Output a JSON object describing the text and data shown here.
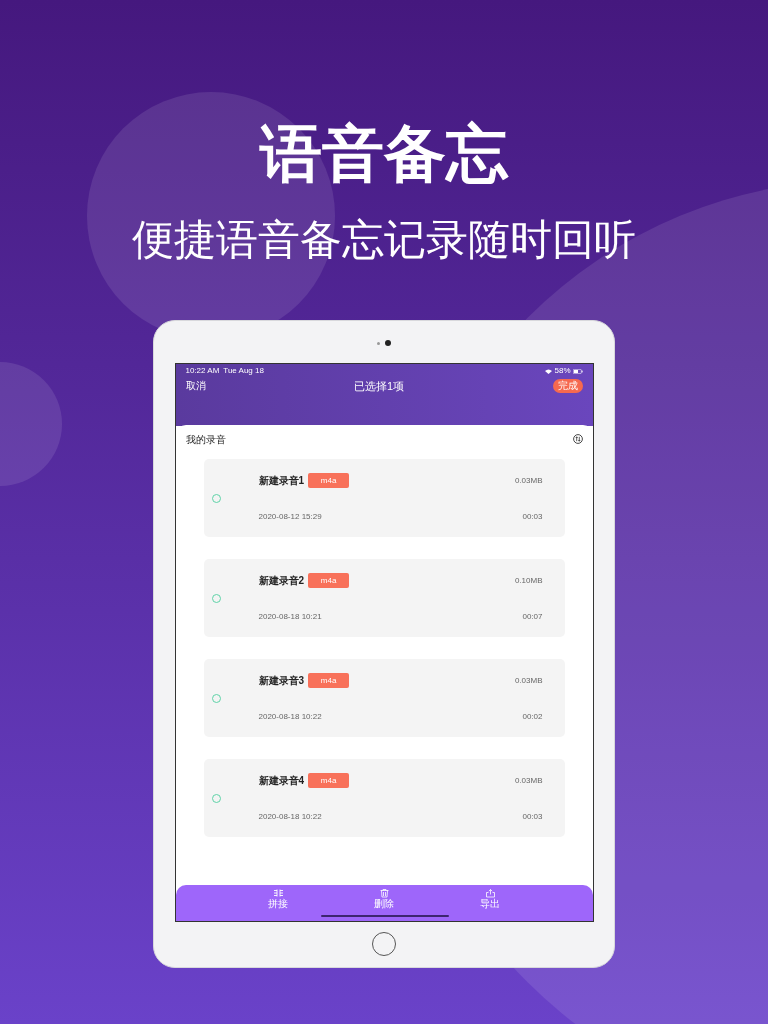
{
  "headline": "语音备忘",
  "subheadline": "便捷语音备忘记录随时回听",
  "status_bar": {
    "time": "10:22 AM",
    "date": "Tue Aug 18",
    "battery": "58%"
  },
  "nav": {
    "cancel": "取消",
    "title": "已选择1项",
    "done": "完成"
  },
  "section_title": "我的录音",
  "recordings": [
    {
      "name": "新建录音1",
      "format": "m4a",
      "size": "0.03MB",
      "date": "2020-08-12 15:29",
      "duration": "00:03",
      "selected": false
    },
    {
      "name": "新建录音2",
      "format": "m4a",
      "size": "0.10MB",
      "date": "2020-08-18 10:21",
      "duration": "00:07",
      "selected": false
    },
    {
      "name": "新建录音3",
      "format": "m4a",
      "size": "0.03MB",
      "date": "2020-08-18 10:22",
      "duration": "00:02",
      "selected": false
    },
    {
      "name": "新建录音4",
      "format": "m4a",
      "size": "0.03MB",
      "date": "2020-08-18 10:22",
      "duration": "00:03",
      "selected": false
    }
  ],
  "toolbar": [
    {
      "kind": "merge",
      "label": "拼接"
    },
    {
      "kind": "delete",
      "label": "删除"
    },
    {
      "kind": "export",
      "label": "导出"
    }
  ]
}
